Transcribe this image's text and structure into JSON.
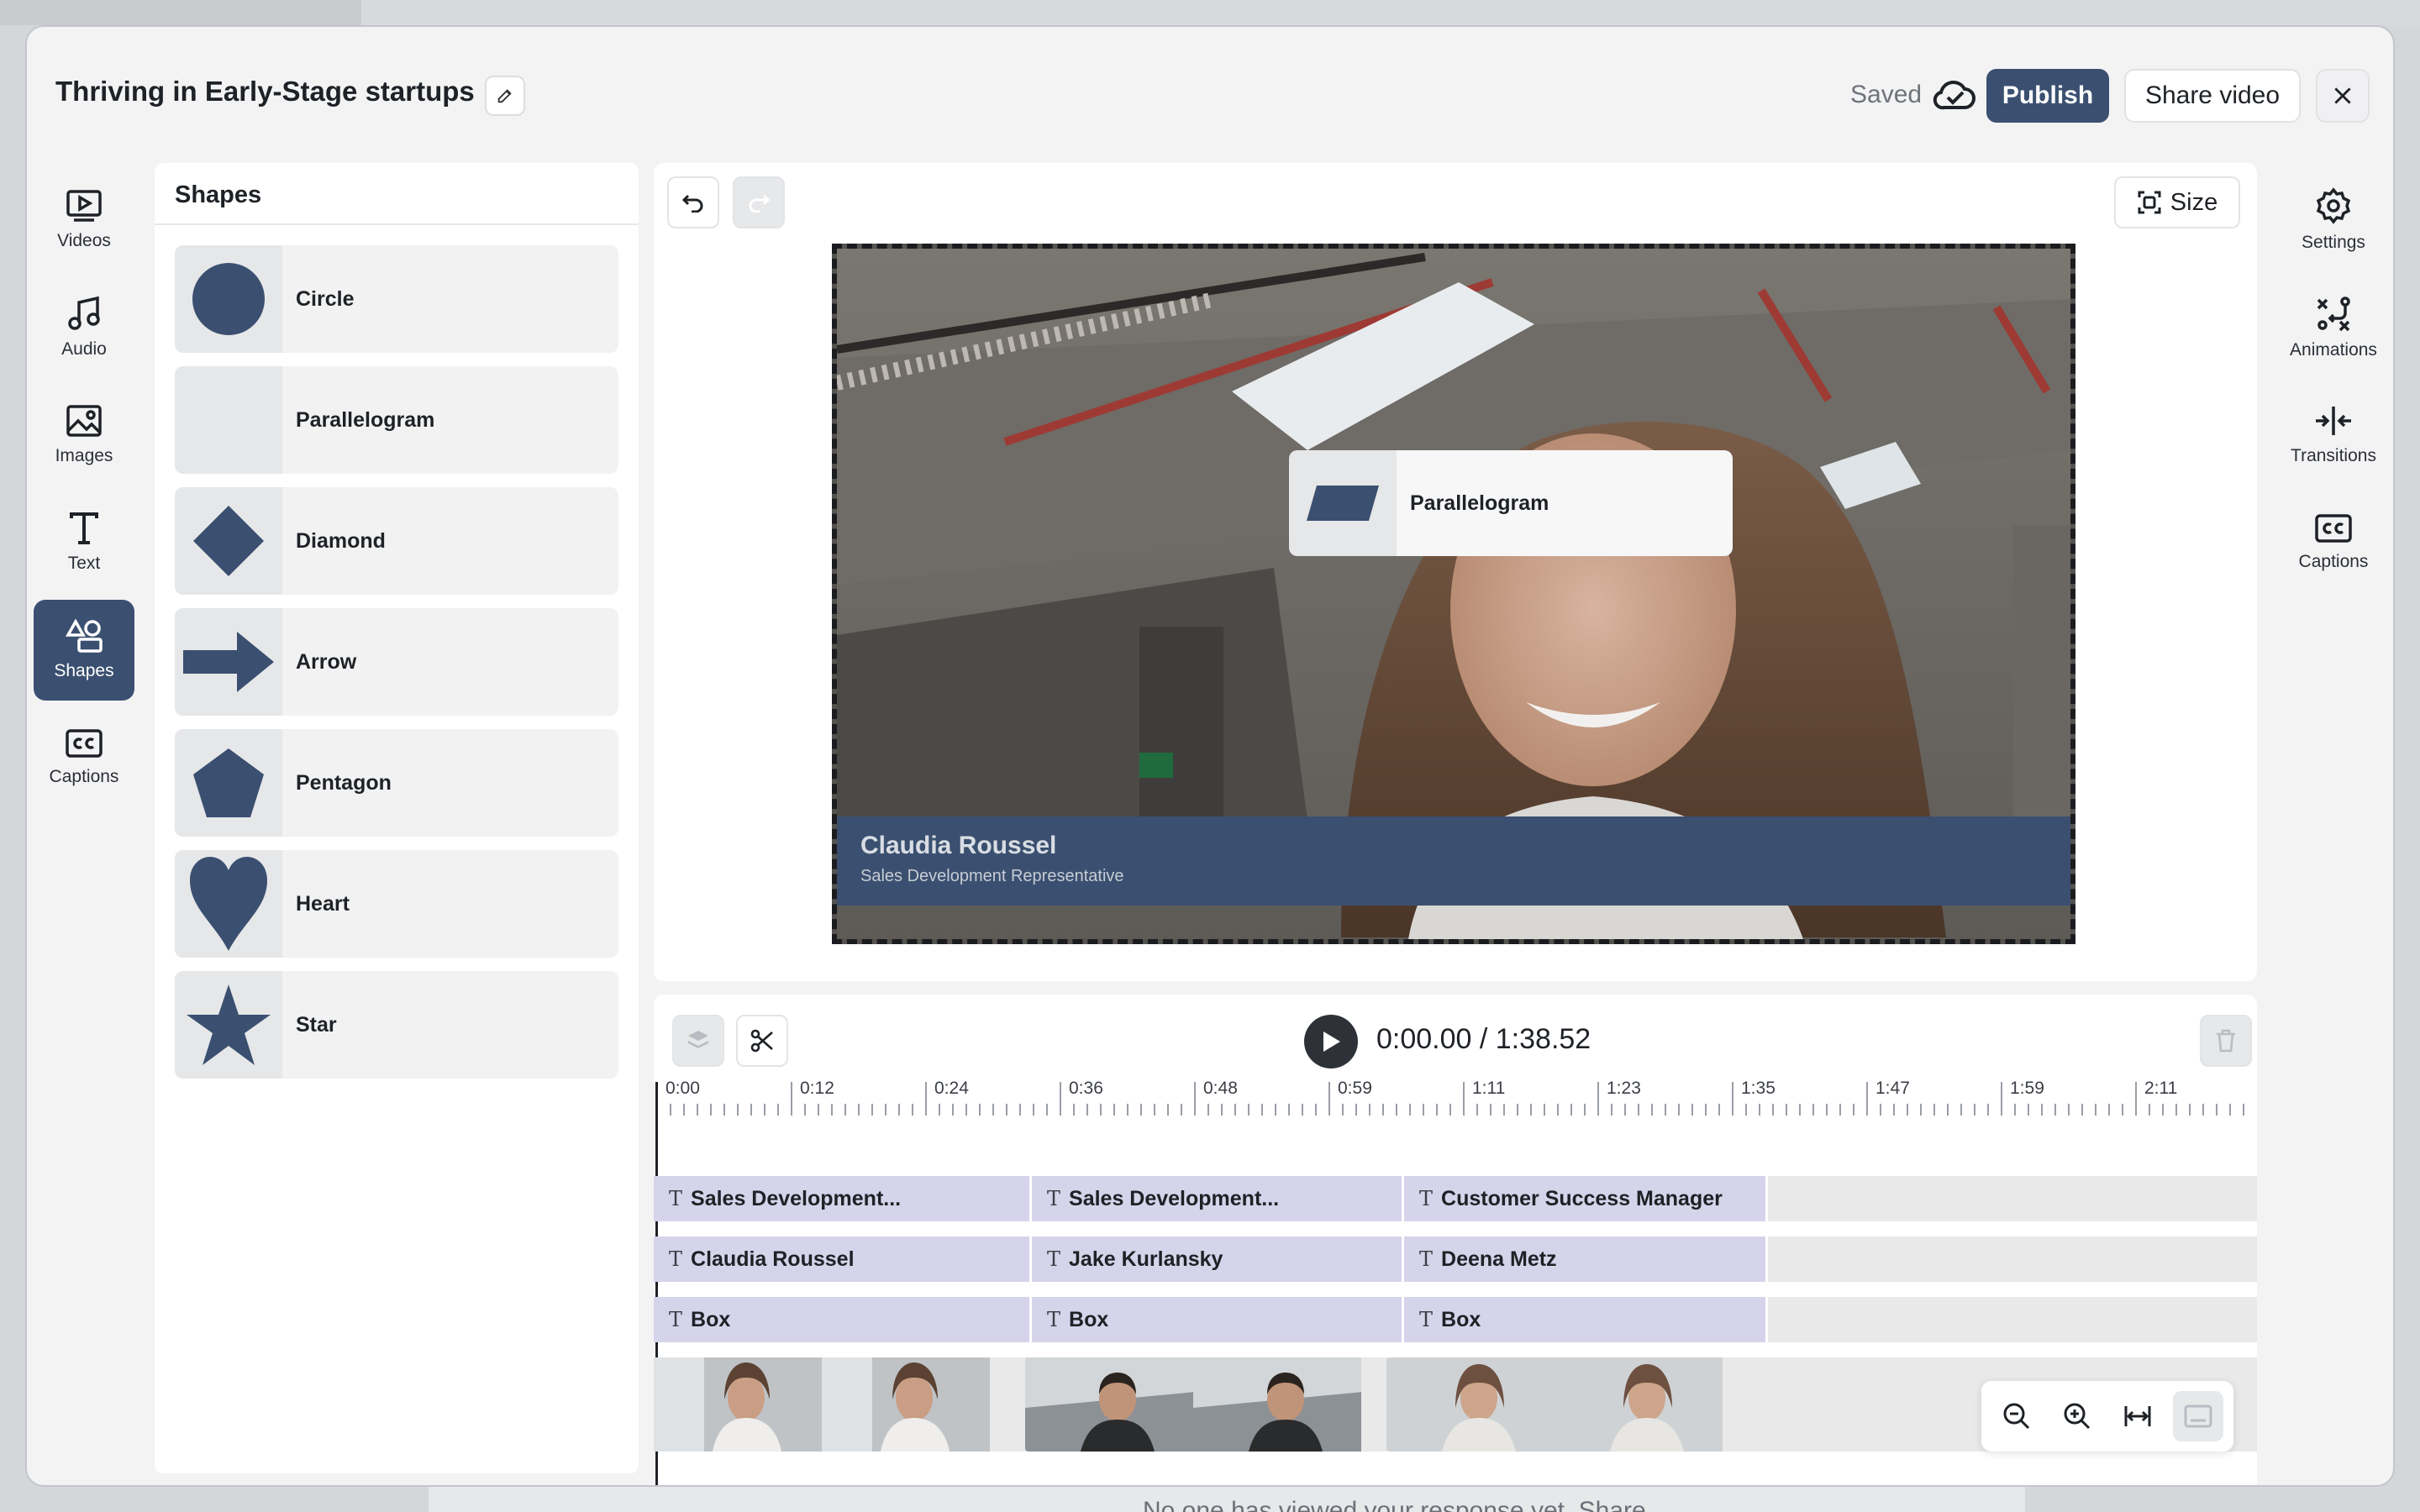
{
  "background": {
    "footer_text": "No one has viewed your response yet. Share"
  },
  "header": {
    "title": "Thriving in Early-Stage startups",
    "saved_label": "Saved",
    "publish_label": "Publish",
    "share_label": "Share video"
  },
  "left_nav": {
    "items": [
      {
        "label": "Videos",
        "icon": "video-icon"
      },
      {
        "label": "Audio",
        "icon": "music-icon"
      },
      {
        "label": "Images",
        "icon": "image-icon"
      },
      {
        "label": "Text",
        "icon": "text-icon"
      },
      {
        "label": "Shapes",
        "icon": "shapes-icon",
        "active": true
      },
      {
        "label": "Captions",
        "icon": "captions-icon"
      }
    ]
  },
  "right_nav": {
    "items": [
      {
        "label": "Settings",
        "icon": "gear-icon"
      },
      {
        "label": "Animations",
        "icon": "animations-icon"
      },
      {
        "label": "Transitions",
        "icon": "transitions-icon"
      },
      {
        "label": "Captions",
        "icon": "captions-icon"
      }
    ]
  },
  "shapes_panel": {
    "title": "Shapes",
    "items": [
      "Circle",
      "Parallelogram",
      "Diamond",
      "Arrow",
      "Pentagon",
      "Heart",
      "Star"
    ]
  },
  "canvas": {
    "size_label": "Size",
    "lower_third": {
      "name": "Claudia Roussel",
      "role": "Sales Development Representative"
    },
    "popup_label": "Parallelogram"
  },
  "timeline": {
    "timecode": "0:00.00 / 1:38.52",
    "ruler_labels": [
      "0:00",
      "0:12",
      "0:24",
      "0:36",
      "0:48",
      "0:59",
      "1:11",
      "1:23",
      "1:35",
      "1:47",
      "1:59",
      "2:11"
    ],
    "tracks": [
      [
        "Sales Development...",
        "Sales Development...",
        "Customer Success Manager"
      ],
      [
        "Claudia Roussel",
        "Jake Kurlansky",
        "Deena Metz"
      ],
      [
        "Box",
        "Box",
        "Box"
      ]
    ]
  },
  "colors": {
    "accent": "#3b5070",
    "clip": "#d6d4ea",
    "shape_fill": "#3b5070"
  }
}
